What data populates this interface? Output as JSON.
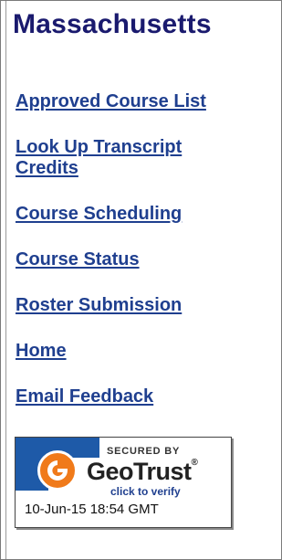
{
  "header": {
    "state_name": "Massachusetts"
  },
  "nav": [
    {
      "label": "Approved Course List"
    },
    {
      "label": "Look Up Transcript Credits"
    },
    {
      "label": "Course Scheduling"
    },
    {
      "label": "Course Status"
    },
    {
      "label": "Roster Submission"
    },
    {
      "label": "Home"
    },
    {
      "label": "Email Feedback"
    }
  ],
  "seal": {
    "secured_by": "SECURED BY",
    "brand": "GeoTrust",
    "trademark": "®",
    "verify": "click to verify",
    "timestamp": "10-Jun-15 18:54 GMT",
    "icon": "geotrust-logo-icon",
    "colors": {
      "orange": "#f07a1a",
      "blue": "#1e5aa8"
    }
  },
  "colors": {
    "title": "#1a1a6e",
    "link": "#1f3f8f"
  }
}
